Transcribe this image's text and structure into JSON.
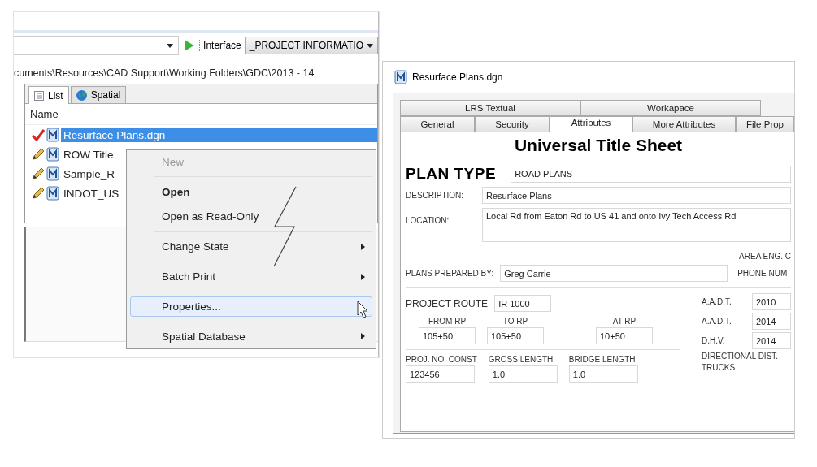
{
  "explorer": {
    "interface_label": "Interface",
    "interface_value": "_PROJECT INFORMATIO",
    "path": "cuments\\Resources\\CAD Support\\Working Folders\\GDC\\2013 - 14",
    "tabs": [
      {
        "label": "List",
        "selected": true
      },
      {
        "label": "Spatial",
        "selected": false
      }
    ],
    "column": "Name",
    "rows": [
      {
        "name": "Resurface Plans.dgn",
        "kind": "check",
        "selected": true
      },
      {
        "name": "ROW Title",
        "kind": "pencil",
        "selected": false
      },
      {
        "name": "Sample_R",
        "kind": "pencil",
        "selected": false
      },
      {
        "name": "INDOT_US",
        "kind": "pencil",
        "selected": false
      }
    ]
  },
  "context_menu": {
    "items": [
      {
        "label": "New",
        "disabled": true,
        "default": false,
        "submenu": false,
        "separator_before": false,
        "selected": false
      },
      {
        "label": "Open",
        "disabled": false,
        "default": true,
        "submenu": false,
        "separator_before": true,
        "selected": false
      },
      {
        "label": "Open as Read-Only",
        "disabled": false,
        "default": false,
        "submenu": false,
        "separator_before": false,
        "selected": false
      },
      {
        "label": "Change State",
        "disabled": false,
        "default": false,
        "submenu": true,
        "separator_before": true,
        "selected": false
      },
      {
        "label": "Batch Print",
        "disabled": false,
        "default": false,
        "submenu": true,
        "separator_before": true,
        "selected": false
      },
      {
        "label": "Properties...",
        "disabled": false,
        "default": false,
        "submenu": false,
        "separator_before": true,
        "selected": true
      },
      {
        "label": "Spatial Database",
        "disabled": false,
        "default": false,
        "submenu": true,
        "separator_before": true,
        "selected": false
      }
    ]
  },
  "dialog": {
    "title": "Resurface Plans.dgn",
    "tab_rows": [
      {
        "tabs": [
          {
            "label": "LRS Textual",
            "selected": false
          },
          {
            "label": "Workapace",
            "selected": false
          }
        ]
      },
      {
        "tabs": [
          {
            "label": "General",
            "selected": false
          },
          {
            "label": "Security",
            "selected": false
          },
          {
            "label": "Attributes",
            "selected": true
          },
          {
            "label": "More Attributes",
            "selected": false
          },
          {
            "label": "File Prop",
            "selected": false
          }
        ]
      }
    ],
    "heading": "Universal Title Sheet",
    "plan_type": {
      "label": "PLAN TYPE",
      "value": "ROAD PLANS"
    },
    "description": {
      "label": "DESCRIPTION:",
      "value": "Resurface Plans"
    },
    "location": {
      "label": "LOCATION:",
      "value": "Local Rd from Eaton Rd to US 41 and onto Ivy Tech Access Rd"
    },
    "area_eng_label": "AREA ENG. C",
    "prepared_by": {
      "label": "PLANS PREPARED BY:",
      "value": "Greg Carrie"
    },
    "phone_label": "PHONE NUM",
    "project_route": {
      "label": "PROJECT ROUTE",
      "value": "IR 1000"
    },
    "rp_fields": [
      {
        "label": "FROM RP",
        "value": "105+50"
      },
      {
        "label": "TO RP",
        "value": "105+50"
      },
      {
        "label": "AT RP",
        "value": "10+50"
      }
    ],
    "lengths": [
      {
        "label": "PROJ. NO. CONST",
        "value": "123456"
      },
      {
        "label": "GROSS LENGTH",
        "value": "1.0"
      },
      {
        "label": "BRIDGE LENGTH",
        "value": "1.0"
      }
    ],
    "traffic": [
      {
        "label": "A.A.D.T.",
        "value": "2010"
      },
      {
        "label": "A.A.D.T.",
        "value": "2014"
      },
      {
        "label": "D.H.V.",
        "value": "2014"
      },
      {
        "label": "DIRECTIONAL DIST."
      },
      {
        "label": "TRUCKS"
      }
    ]
  }
}
